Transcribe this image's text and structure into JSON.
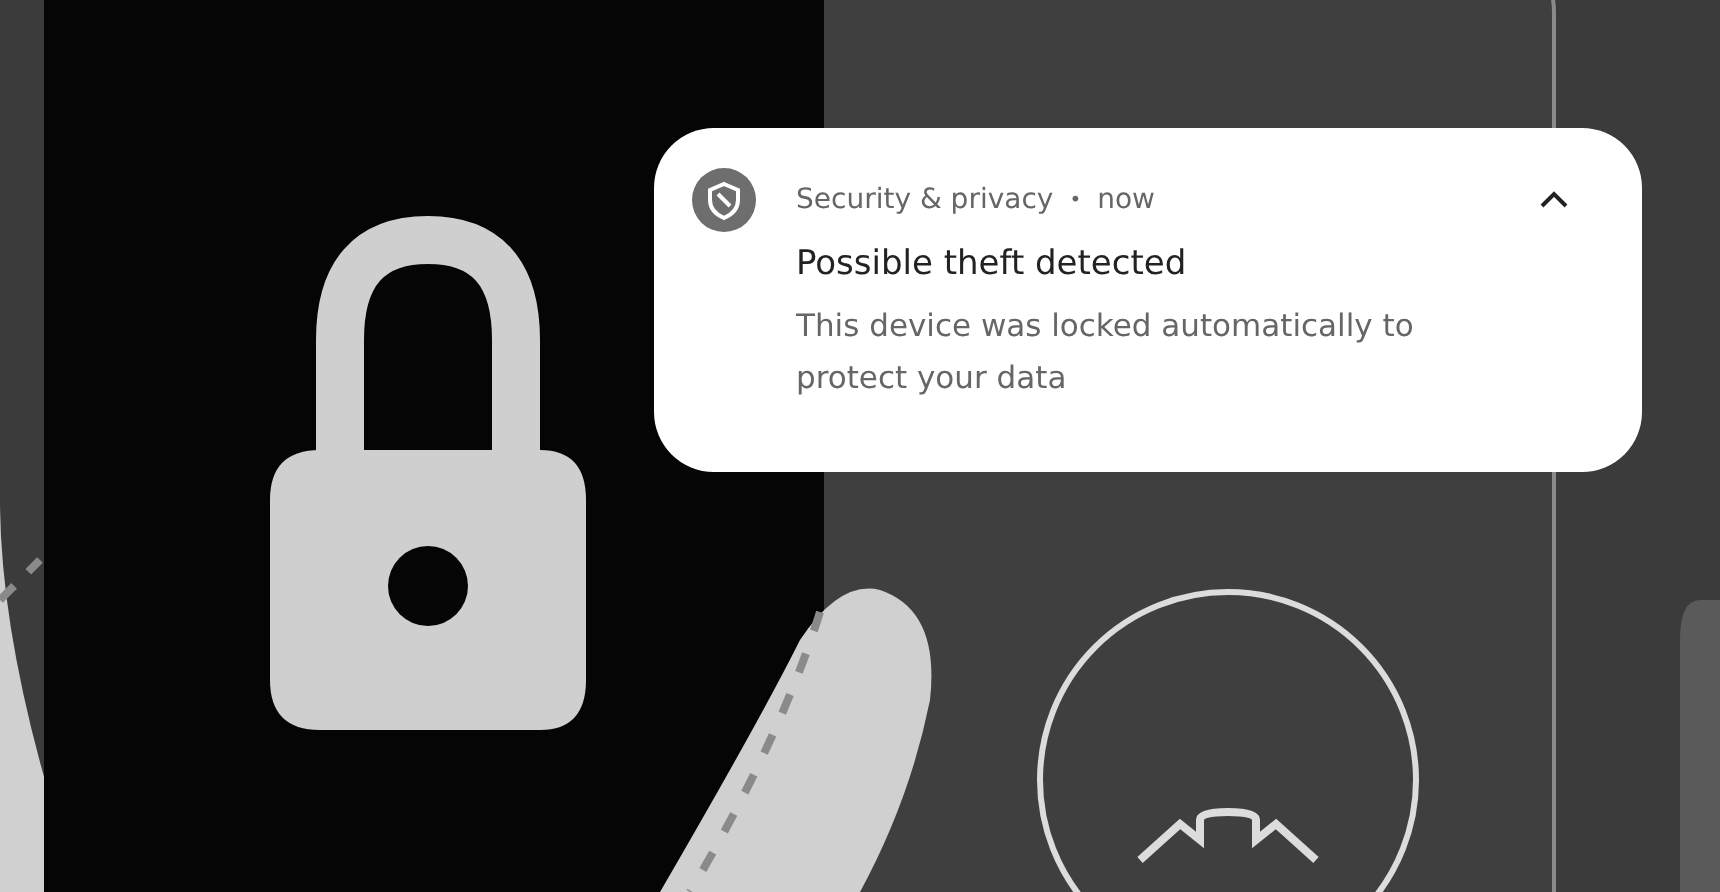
{
  "notification": {
    "app_name": "Security & privacy",
    "separator": "•",
    "time": "now",
    "expanded": true,
    "title": "Possible theft detected",
    "body": "This device was locked automatically to protect your data"
  }
}
